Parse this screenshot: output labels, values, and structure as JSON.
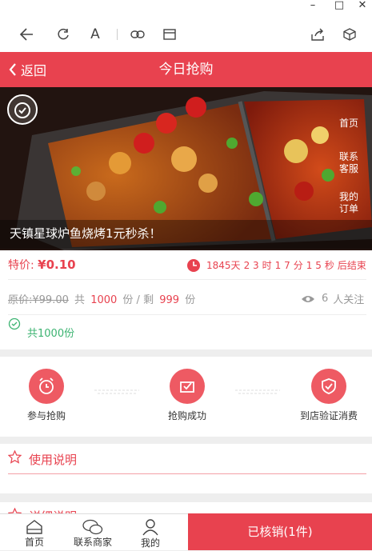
{
  "window": {
    "minimize": "–",
    "maximize": "□",
    "close": "✕"
  },
  "toolbar": {
    "icons": [
      "back-arrow-icon",
      "refresh-icon",
      "font-icon",
      "link-icon",
      "reader-icon",
      "share-icon",
      "cube-icon"
    ],
    "font_glyph": "A"
  },
  "header": {
    "back_label": "返回",
    "title": "今日抢购"
  },
  "hero": {
    "caption": "天镇星球炉鱼烧烤1元秒杀！",
    "side_links": [
      "首页",
      "联系\n客服",
      "我的\n订单"
    ]
  },
  "deal": {
    "price_label": "特价:",
    "price": "¥0.10",
    "countdown": {
      "days": "1845",
      "days_unit": "天",
      "hours": "2 3",
      "hours_unit": "时",
      "minutes": "1 7",
      "minutes_unit": "分",
      "seconds": "1 5",
      "seconds_unit": "秒",
      "suffix": "后结束"
    },
    "orig_label": "原价:",
    "orig_price": "¥99.00",
    "total_prefix": "共",
    "total": "1000",
    "total_unit": "份 / 剩",
    "remaining": "999",
    "remaining_unit": "份",
    "watchers": "6",
    "watchers_label": "人关注",
    "sold_note": "共1000份"
  },
  "steps": [
    {
      "label": "参与抢购",
      "icon": "alarm-clock-icon"
    },
    {
      "label": "抢购成功",
      "icon": "check-box-icon"
    },
    {
      "label": "到店验证消费",
      "icon": "shield-check-icon"
    }
  ],
  "sections": {
    "usage_title": "使用说明",
    "details_title": "详细说明"
  },
  "bottom_nav": {
    "items": [
      "首页",
      "联系商家",
      "我的"
    ],
    "cta": "已核销(1件)"
  },
  "colors": {
    "accent": "#e8424f",
    "step_circle": "#ee5a63",
    "green": "#3cb371"
  }
}
